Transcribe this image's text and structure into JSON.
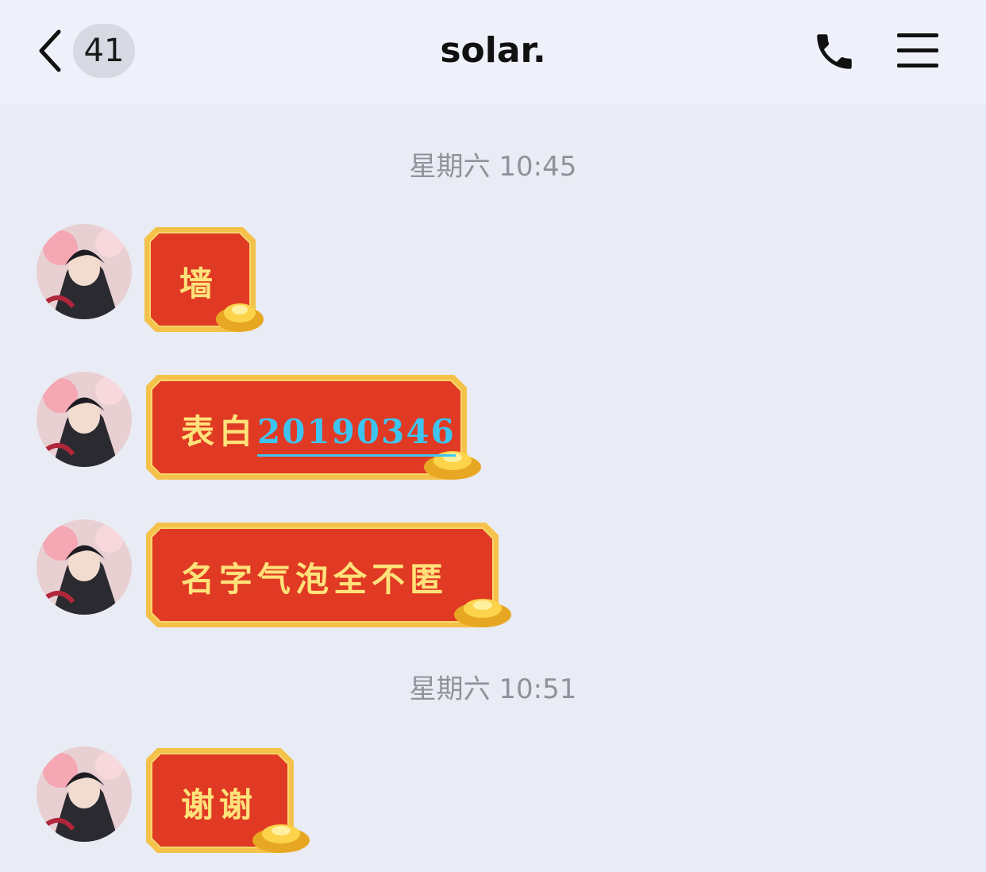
{
  "header": {
    "back_badge": "41",
    "title": "solar."
  },
  "icons": {
    "back": "chevron-left-icon",
    "phone": "phone-icon",
    "menu": "hamburger-menu-icon"
  },
  "colors": {
    "bubble_red": "#e03a24",
    "bubble_gold": "#f4c24a",
    "bubble_text": "#ffe27a",
    "link": "#3ec4f0"
  },
  "timestamps": [
    "星期六 10:45",
    "星期六 10:51"
  ],
  "messages": [
    {
      "text": "墙"
    },
    {
      "text": "表白",
      "link": "20190346"
    },
    {
      "text": "名字气泡全不匿"
    },
    {
      "text": "谢谢"
    }
  ]
}
